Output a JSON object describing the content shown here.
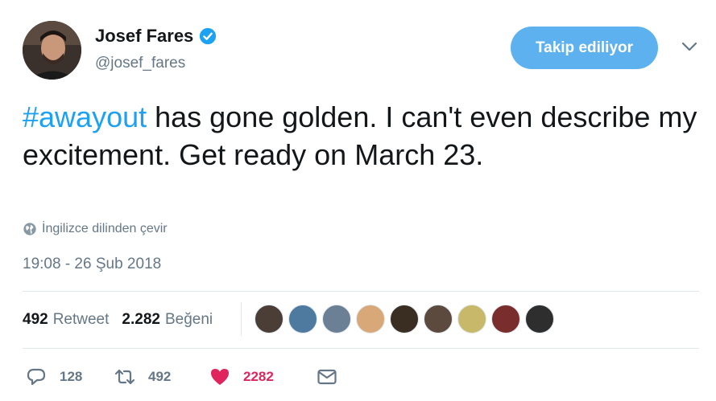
{
  "author": {
    "name": "Josef Fares",
    "handle": "@josef_fares",
    "verified_icon": "verified-badge-icon",
    "avatar_icon": "profile-avatar"
  },
  "follow_button": {
    "label": "Takip ediliyor",
    "color": "#5eb1ef"
  },
  "menu_icon": "chevron-down-icon",
  "tweet": {
    "hashtag": "#awayout",
    "text": " has gone golden. I can't even describe my excitement. Get ready on March 23."
  },
  "translate": {
    "icon": "globe-icon",
    "label": "İngilizce dilinden çevir"
  },
  "timestamp": "19:08 - 26 Şub 2018",
  "stats": {
    "retweets_count": "492",
    "retweets_label": "Retweet",
    "likes_count": "2.282",
    "likes_label": "Beğeni"
  },
  "likers": [
    {
      "color": "#4a3e36"
    },
    {
      "color": "#4f7aa0"
    },
    {
      "color": "#6b7f95"
    },
    {
      "color": "#d9a878"
    },
    {
      "color": "#3a2d22"
    },
    {
      "color": "#5c4a3f"
    },
    {
      "color": "#c8b96a"
    },
    {
      "color": "#7a2d2d"
    },
    {
      "color": "#2e2e2e"
    }
  ],
  "actions": {
    "reply_count": "128",
    "retweet_count": "492",
    "like_count": "2282"
  },
  "colors": {
    "link": "#1da1f2",
    "secondary": "#657786",
    "like": "#e0245e",
    "divider": "#e1e8ed"
  }
}
